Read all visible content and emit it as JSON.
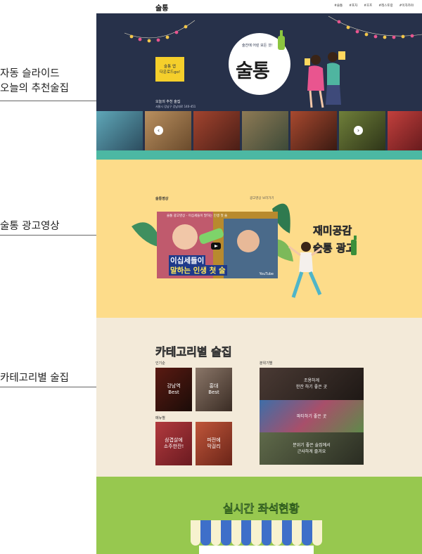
{
  "annotations": [
    {
      "line1": "자동 슬라이드",
      "line2": "오늘의 추천술집"
    },
    {
      "line1": "술통 광고영상",
      "line2": ""
    },
    {
      "line1": "카테고리별 술집",
      "line2": ""
    }
  ],
  "nav": {
    "logo": "술통",
    "menu": [
      "#술통",
      "#포차",
      "#호프",
      "#레스토랑",
      "#이자카야"
    ]
  },
  "hero": {
    "badge_line1": "술통 앱",
    "badge_line2": "다운로드go!",
    "slogan": "술잔에 어린 모든 것!",
    "title": "술통",
    "subtitle": "오늘의 추천 술집",
    "address": "서울시 강남구 강남대로 140-451",
    "colors": {
      "background": "#27314a",
      "accent": "#4cb8a3",
      "badge": "#f5cf2b"
    }
  },
  "ad": {
    "heading": "술통영상",
    "more": "광고영상 보러가기",
    "video": {
      "title": "술통 광고영상 - 이십세들이 말하는 인생 첫 술",
      "caption_line1": "이십세들이",
      "caption_line2": "말하는 인생 첫 술",
      "platform": "YouTube"
    },
    "slogan_line1": "재미공감",
    "slogan_line2": "술통 광고",
    "colors": {
      "background": "#fddc8a"
    }
  },
  "category": {
    "title": "카테고리별 술집",
    "popular_label": "인기순",
    "menu_label": "메뉴별",
    "mood_label": "분위기별",
    "popular": [
      {
        "line1": "강남역",
        "line2": "Best"
      },
      {
        "line1": "홍대",
        "line2": "Best"
      }
    ],
    "menu": [
      {
        "line1": "삼겹살에",
        "line2": "소주한잔!"
      },
      {
        "line1": "파전에",
        "line2": "막걸리"
      }
    ],
    "mood": [
      {
        "line1": "조용하게",
        "line2": "한잔 하기 좋은 곳"
      },
      {
        "line1": "파티하기 좋은 곳",
        "line2": ""
      },
      {
        "line1": "분위기 좋은 술집에서",
        "line2": "근사하게 즐겨요"
      }
    ],
    "colors": {
      "background": "#f3ead9"
    }
  },
  "seats": {
    "title": "실시간 좌석현황",
    "colors": {
      "background": "#97c84f",
      "stripe_blue": "#3e6fc9",
      "stripe_light": "#f7f2cf"
    }
  }
}
